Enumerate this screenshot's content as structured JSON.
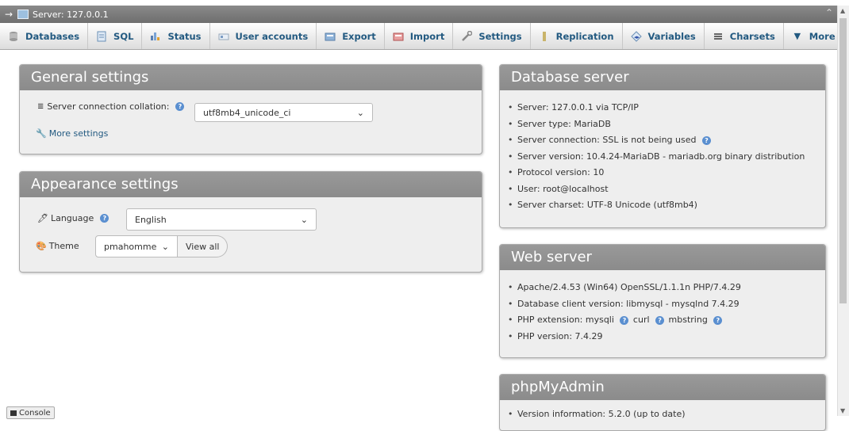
{
  "breadcrumb": {
    "server": "Server: 127.0.0.1"
  },
  "tabs": [
    {
      "label": "Databases",
      "icon": "database-icon"
    },
    {
      "label": "SQL",
      "icon": "sql-icon"
    },
    {
      "label": "Status",
      "icon": "status-icon"
    },
    {
      "label": "User accounts",
      "icon": "users-icon"
    },
    {
      "label": "Export",
      "icon": "export-icon"
    },
    {
      "label": "Import",
      "icon": "import-icon"
    },
    {
      "label": "Settings",
      "icon": "wrench-icon"
    },
    {
      "label": "Replication",
      "icon": "replication-icon"
    },
    {
      "label": "Variables",
      "icon": "variables-icon"
    },
    {
      "label": "Charsets",
      "icon": "charsets-icon"
    },
    {
      "label": "More",
      "icon": "caret-down-icon"
    }
  ],
  "general": {
    "title": "General settings",
    "collation_label": "Server connection collation:",
    "collation_value": "utf8mb4_unicode_ci",
    "more_settings": "More settings"
  },
  "appearance": {
    "title": "Appearance settings",
    "language_label": "Language",
    "language_value": "English",
    "theme_label": "Theme",
    "theme_value": "pmahomme",
    "view_all": "View all"
  },
  "db_server": {
    "title": "Database server",
    "items": [
      "Server: 127.0.0.1 via TCP/IP",
      "Server type: MariaDB",
      "Server connection: SSL is not being used",
      "Server version: 10.4.24-MariaDB - mariadb.org binary distribution",
      "Protocol version: 10",
      "User: root@localhost",
      "Server charset: UTF-8 Unicode (utf8mb4)"
    ]
  },
  "web_server": {
    "title": "Web server",
    "items": [
      "Apache/2.4.53 (Win64) OpenSSL/1.1.1n PHP/7.4.29",
      "Database client version: libmysql - mysqlnd 7.4.29"
    ],
    "php_ext_label": "PHP extension: mysqli",
    "php_ext_curl": "curl",
    "php_ext_mbstring": "mbstring",
    "php_version": "PHP version: 7.4.29"
  },
  "pma": {
    "title": "phpMyAdmin",
    "first_item": "Version information: 5.2.0 (up to date)"
  },
  "console": {
    "label": "Console"
  },
  "colors": {
    "header": "#8e8e8e",
    "panel": "#eeeeee",
    "link": "#235a81"
  }
}
